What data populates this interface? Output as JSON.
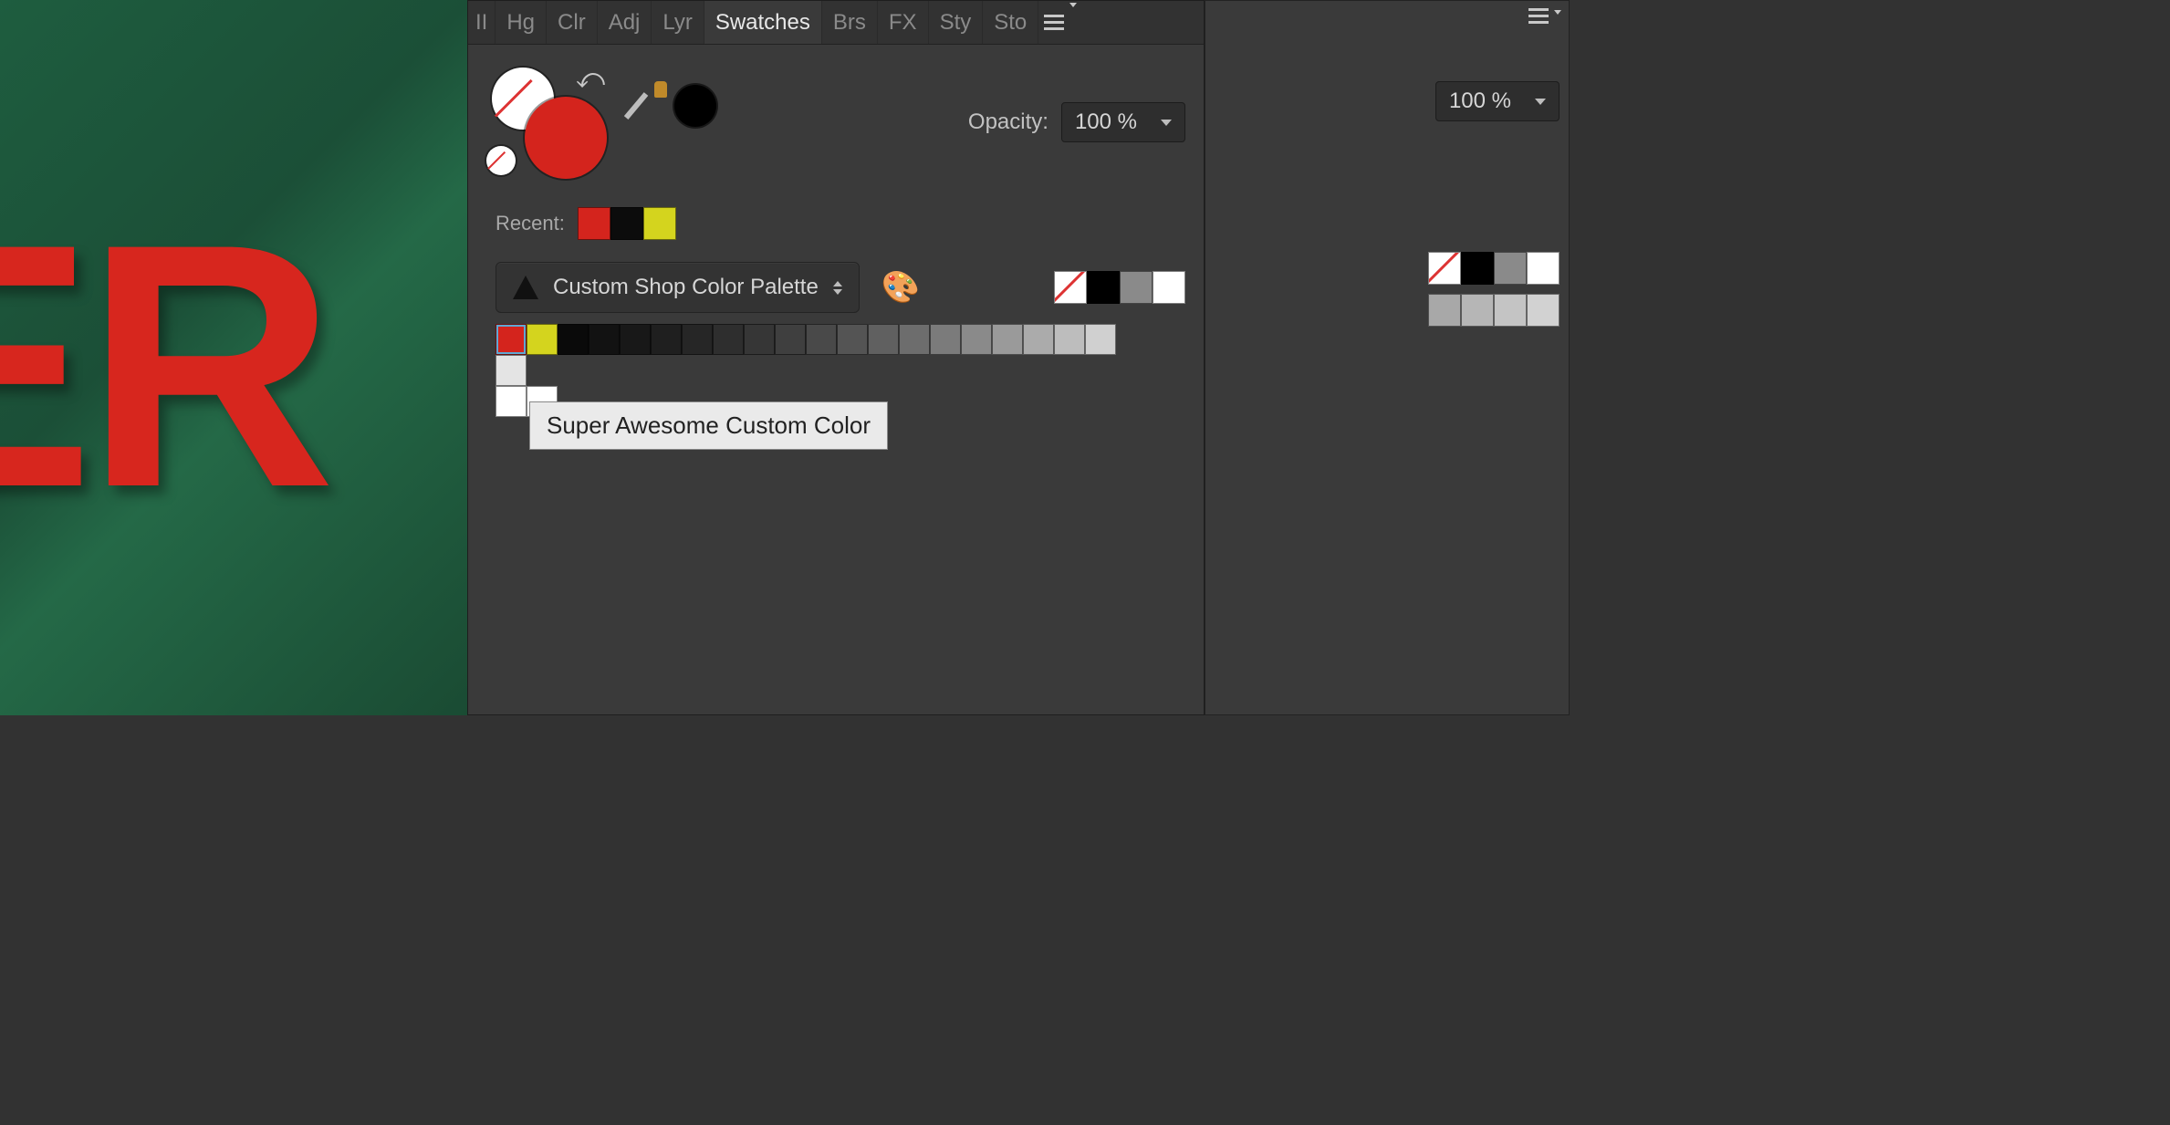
{
  "tabs": {
    "pipes": "II",
    "hg": "Hg",
    "clr": "Clr",
    "adj": "Adj",
    "lyr": "Lyr",
    "swatches": "Swatches",
    "brs": "Brs",
    "fx": "FX",
    "sty": "Sty",
    "sto": "Sto"
  },
  "opacity": {
    "label": "Opacity:",
    "value": "100 %",
    "value_bg": "100 %"
  },
  "color_pair": {
    "front_stroke": "#ffffff",
    "front_fill": "#d4241d"
  },
  "picked_color": "#000000",
  "recent": {
    "label": "Recent:",
    "colors": [
      "#d4241d",
      "#0c0c0c",
      "#d4d41e"
    ]
  },
  "palette": {
    "name": "Custom Shop Color Palette",
    "quick": [
      "none",
      "#000000",
      "#8a8a8a",
      "#ffffff"
    ],
    "swatches": [
      "#d4241d",
      "#d4d41e",
      "#0a0a0a",
      "#121212",
      "#181818",
      "#1f1f1f",
      "#262626",
      "#2e2e2e",
      "#363636",
      "#3f3f3f",
      "#494949",
      "#545454",
      "#606060",
      "#6d6d6d",
      "#7b7b7b",
      "#8a8a8a",
      "#9a9a9a",
      "#ababab",
      "#bdbdbd",
      "#d0d0d0",
      "#e4e4e4",
      "#ffffff",
      "#ffffff"
    ]
  },
  "bg_panel": {
    "row_a": [
      "none",
      "#000000",
      "#8a8a8a",
      "#ffffff"
    ],
    "row_b": [
      "#a8a8a8",
      "#b6b6b6",
      "#c4c4c4",
      "#d2d2d2"
    ]
  },
  "tooltip": "Super Awesome Custom Color"
}
